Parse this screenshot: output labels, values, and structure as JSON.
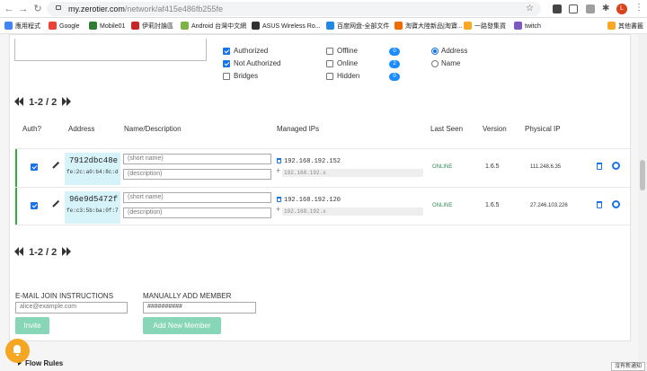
{
  "browser": {
    "url_host": "my.zerotier.com",
    "url_path": "/network/af415e486fb255fe",
    "profile_initial": "L"
  },
  "bookmarks": [
    {
      "label": "應用程式",
      "color": "#4285f4"
    },
    {
      "label": "Google",
      "color": "#ea4335"
    },
    {
      "label": "Mobile01",
      "color": "#2e7d32"
    },
    {
      "label": "伊莉討論區",
      "color": "#c62828"
    },
    {
      "label": "Android 台灣中文網",
      "color": "#7cb342"
    },
    {
      "label": "ASUS Wireless Ro...",
      "color": "#333333"
    },
    {
      "label": "百度网盘-全部文件",
      "color": "#1e88e5"
    },
    {
      "label": "淘寶大陸新品|淘寶...",
      "color": "#ef6c00"
    },
    {
      "label": "一路發集貨",
      "color": "#f9a825"
    },
    {
      "label": "twitch",
      "color": "#7e57c2"
    },
    {
      "label": "其他書籤",
      "color": "#f9a825"
    }
  ],
  "filters": {
    "auth": [
      {
        "label": "Authorized",
        "checked": true
      },
      {
        "label": "Not Authorized",
        "checked": true
      },
      {
        "label": "Bridges",
        "checked": false
      }
    ],
    "status": [
      {
        "label": "Offline",
        "checked": false,
        "count": "0"
      },
      {
        "label": "Online",
        "checked": false,
        "count": "2"
      },
      {
        "label": "Hidden",
        "checked": false,
        "count": "0"
      }
    ],
    "sort": [
      {
        "label": "Address",
        "selected": true
      },
      {
        "label": "Name",
        "selected": false
      }
    ]
  },
  "pager": {
    "text": "1-2 / 2"
  },
  "columns": {
    "auth": "Auth?",
    "address": "Address",
    "name": "Name/Description",
    "ips": "Managed IPs",
    "last_seen": "Last Seen",
    "version": "Version",
    "physical_ip": "Physical IP"
  },
  "members": [
    {
      "authorized": true,
      "address": "7912dbc48e",
      "mac": "fe:2c:a0:b4:8c:d",
      "name_placeholder": "(short name)",
      "desc_placeholder": "(description)",
      "ip": "192.168.192.152",
      "ip_placeholder": "192.168.192.x",
      "last_seen": "ONLINE",
      "version": "1.6.5",
      "physical_ip": "111.248.6.35"
    },
    {
      "authorized": true,
      "address": "96e9d5472f",
      "mac": "fe:c3:5b:ba:0f:7",
      "name_placeholder": "(short name)",
      "desc_placeholder": "(description)",
      "ip": "192.168.192.120",
      "ip_placeholder": "192.168.192.x",
      "last_seen": "ONLINE",
      "version": "1.6.5",
      "physical_ip": "27.246.103.226"
    }
  ],
  "email": {
    "heading": "E-MAIL JOIN INSTRUCTIONS",
    "placeholder": "alice@example.com",
    "button": "Invite"
  },
  "manual": {
    "heading": "MANUALLY ADD MEMBER",
    "placeholder": "##########",
    "button": "Add New Member"
  },
  "flow_rules": {
    "label": "Flow Rules"
  },
  "notification": {
    "text": "沒有新通知"
  },
  "colors": {
    "accent": "#1a73e8",
    "online_green": "#2eae3a",
    "button_teal": "#88d6b8",
    "bell_orange": "#f5a623"
  }
}
